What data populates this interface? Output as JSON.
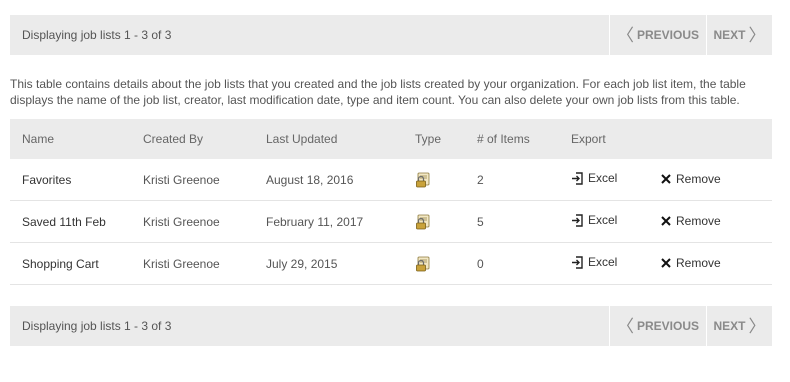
{
  "pager_top": {
    "status": "Displaying job lists 1 - 3 of 3",
    "previous": "PREVIOUS",
    "next": "NEXT"
  },
  "description": "This table contains details about the job lists that you created and the job lists created by your organization. For each job list item, the table displays the name of the job list, creator, last modification date, type and item count. You can also delete your own job lists from this table.",
  "table": {
    "columns": [
      "Name",
      "Created By",
      "Last Updated",
      "Type",
      "# of Items",
      "Export"
    ],
    "rows": [
      {
        "name": "Favorites",
        "created_by": "Kristi Greenoe",
        "last_updated": "August 18, 2016",
        "type_icon": "lock-list-icon",
        "items": "2",
        "export": "Excel",
        "remove": "Remove"
      },
      {
        "name": "Saved 11th Feb",
        "created_by": "Kristi Greenoe",
        "last_updated": "February 11, 2017",
        "type_icon": "lock-list-icon",
        "items": "5",
        "export": "Excel",
        "remove": "Remove"
      },
      {
        "name": "Shopping Cart",
        "created_by": "Kristi Greenoe",
        "last_updated": "July 29, 2015",
        "type_icon": "lock-list-icon",
        "items": "0",
        "export": "Excel",
        "remove": "Remove"
      }
    ]
  },
  "pager_bottom": {
    "status": "Displaying job lists 1 - 3 of 3",
    "previous": "PREVIOUS",
    "next": "NEXT"
  },
  "colors": {
    "bar_background": "#ebebeb",
    "muted_text": "#8a8a8a",
    "lock_icon": "#c9a23a"
  }
}
